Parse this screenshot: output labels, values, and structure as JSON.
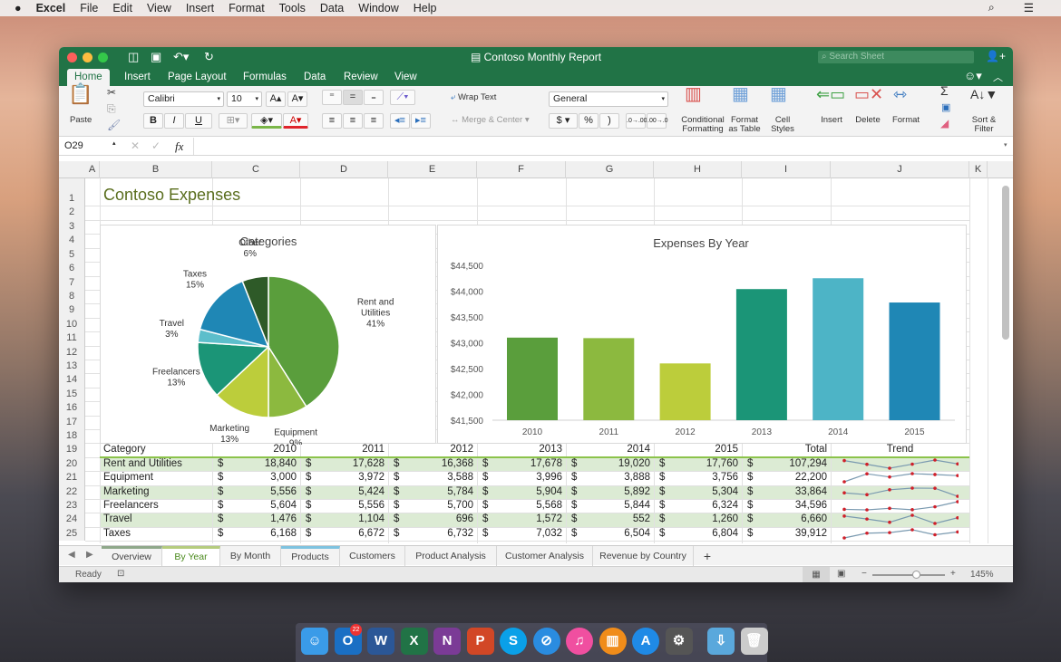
{
  "menubar": {
    "apple": "",
    "app": "Excel",
    "items": [
      "File",
      "Edit",
      "View",
      "Insert",
      "Format",
      "Tools",
      "Data",
      "Window",
      "Help"
    ]
  },
  "window": {
    "title": "Contoso Monthly Report",
    "search_placeholder": "Search Sheet",
    "ribbon_tabs": [
      "Home",
      "Insert",
      "Page Layout",
      "Formulas",
      "Data",
      "Review",
      "View"
    ],
    "active_tab": "Home"
  },
  "ribbon": {
    "paste": "Paste",
    "font": "Calibri",
    "font_size": "10",
    "bold": "B",
    "italic": "I",
    "underline": "U",
    "wrap_text": "Wrap Text",
    "merge_center": "Merge & Center",
    "number_format": "General",
    "currency": "$",
    "percent": "%",
    "comma": ")",
    "inc_decimal": ".0→.00",
    "dec_decimal": ".00→.0",
    "conditional_formatting": [
      "Conditional",
      "Formatting"
    ],
    "format_as_table": [
      "Format",
      "as Table"
    ],
    "cell_styles": [
      "Cell",
      "Styles"
    ],
    "insert": "Insert",
    "delete": "Delete",
    "format": "Format",
    "sort_filter": [
      "Sort &",
      "Filter"
    ]
  },
  "formula_bar": {
    "name_box": "O29",
    "fx": "fx",
    "value": ""
  },
  "columns": [
    "A",
    "B",
    "C",
    "D",
    "E",
    "F",
    "G",
    "H",
    "I",
    "J",
    "K"
  ],
  "sheet": {
    "title": "Contoso Expenses",
    "header": [
      "Category",
      "2010",
      "2011",
      "2012",
      "2013",
      "2014",
      "2015",
      "Total",
      "Trend"
    ],
    "rows": [
      {
        "category": "Rent and Utilities",
        "values": [
          "18,840",
          "17,628",
          "16,368",
          "17,678",
          "19,020",
          "17,760"
        ],
        "total": "107,294"
      },
      {
        "category": "Equipment",
        "values": [
          "3,000",
          "3,972",
          "3,588",
          "3,996",
          "3,888",
          "3,756"
        ],
        "total": "22,200"
      },
      {
        "category": "Marketing",
        "values": [
          "5,556",
          "5,424",
          "5,784",
          "5,904",
          "5,892",
          "5,304"
        ],
        "total": "33,864"
      },
      {
        "category": "Freelancers",
        "values": [
          "5,604",
          "5,556",
          "5,700",
          "5,568",
          "5,844",
          "6,324"
        ],
        "total": "34,596"
      },
      {
        "category": "Travel",
        "values": [
          "1,476",
          "1,104",
          "696",
          "1,572",
          "552",
          "1,260"
        ],
        "total": "6,660"
      },
      {
        "category": "Taxes",
        "values": [
          "6,168",
          "6,672",
          "6,732",
          "7,032",
          "6,504",
          "6,804"
        ],
        "total": "39,912"
      }
    ],
    "currency_symbol": "$"
  },
  "chart_data": [
    {
      "type": "pie",
      "title": "Categories",
      "labels": [
        "Rent and Utilities",
        "Equipment",
        "Marketing",
        "Freelancers",
        "Travel",
        "Taxes",
        "Other"
      ],
      "values": [
        41,
        9,
        13,
        13,
        3,
        15,
        6
      ],
      "colors": [
        "#5a9e3c",
        "#8cb93f",
        "#bccd3b",
        "#1b9577",
        "#5cbecb",
        "#1f87b5",
        "#2e5a28"
      ]
    },
    {
      "type": "bar",
      "title": "Expenses By Year",
      "categories": [
        "2010",
        "2011",
        "2012",
        "2013",
        "2014",
        "2015"
      ],
      "values": [
        43100,
        43090,
        42600,
        44040,
        44250,
        43780
      ],
      "ylim": [
        41500,
        44500
      ],
      "yticks": [
        "$44,500",
        "$44,000",
        "$43,500",
        "$43,000",
        "$42,500",
        "$42,000",
        "$41,500"
      ],
      "colors": [
        "#5a9e3c",
        "#8cb93f",
        "#bccd3b",
        "#1b9577",
        "#4db4c6",
        "#1f87b5"
      ],
      "grid": false
    }
  ],
  "sheet_tabs": [
    "Overview",
    "By Year",
    "By Month",
    "Products",
    "Customers",
    "Product Analysis",
    "Customer Analysis",
    "Revenue by Country"
  ],
  "active_sheet": "By Year",
  "status": {
    "text": "Ready",
    "zoom": "145%",
    "zoom_level": 0.6
  },
  "dock": [
    "Finder",
    "Outlook",
    "Word",
    "Excel",
    "OneNote",
    "PowerPoint",
    "Skype",
    "Safari",
    "iTunes",
    "iBooks",
    "App Store",
    "System Preferences",
    "Downloads",
    "Trash"
  ],
  "dock_badge": "22",
  "colors": {
    "excel_green": "#217346",
    "band": "#dcebd4"
  }
}
